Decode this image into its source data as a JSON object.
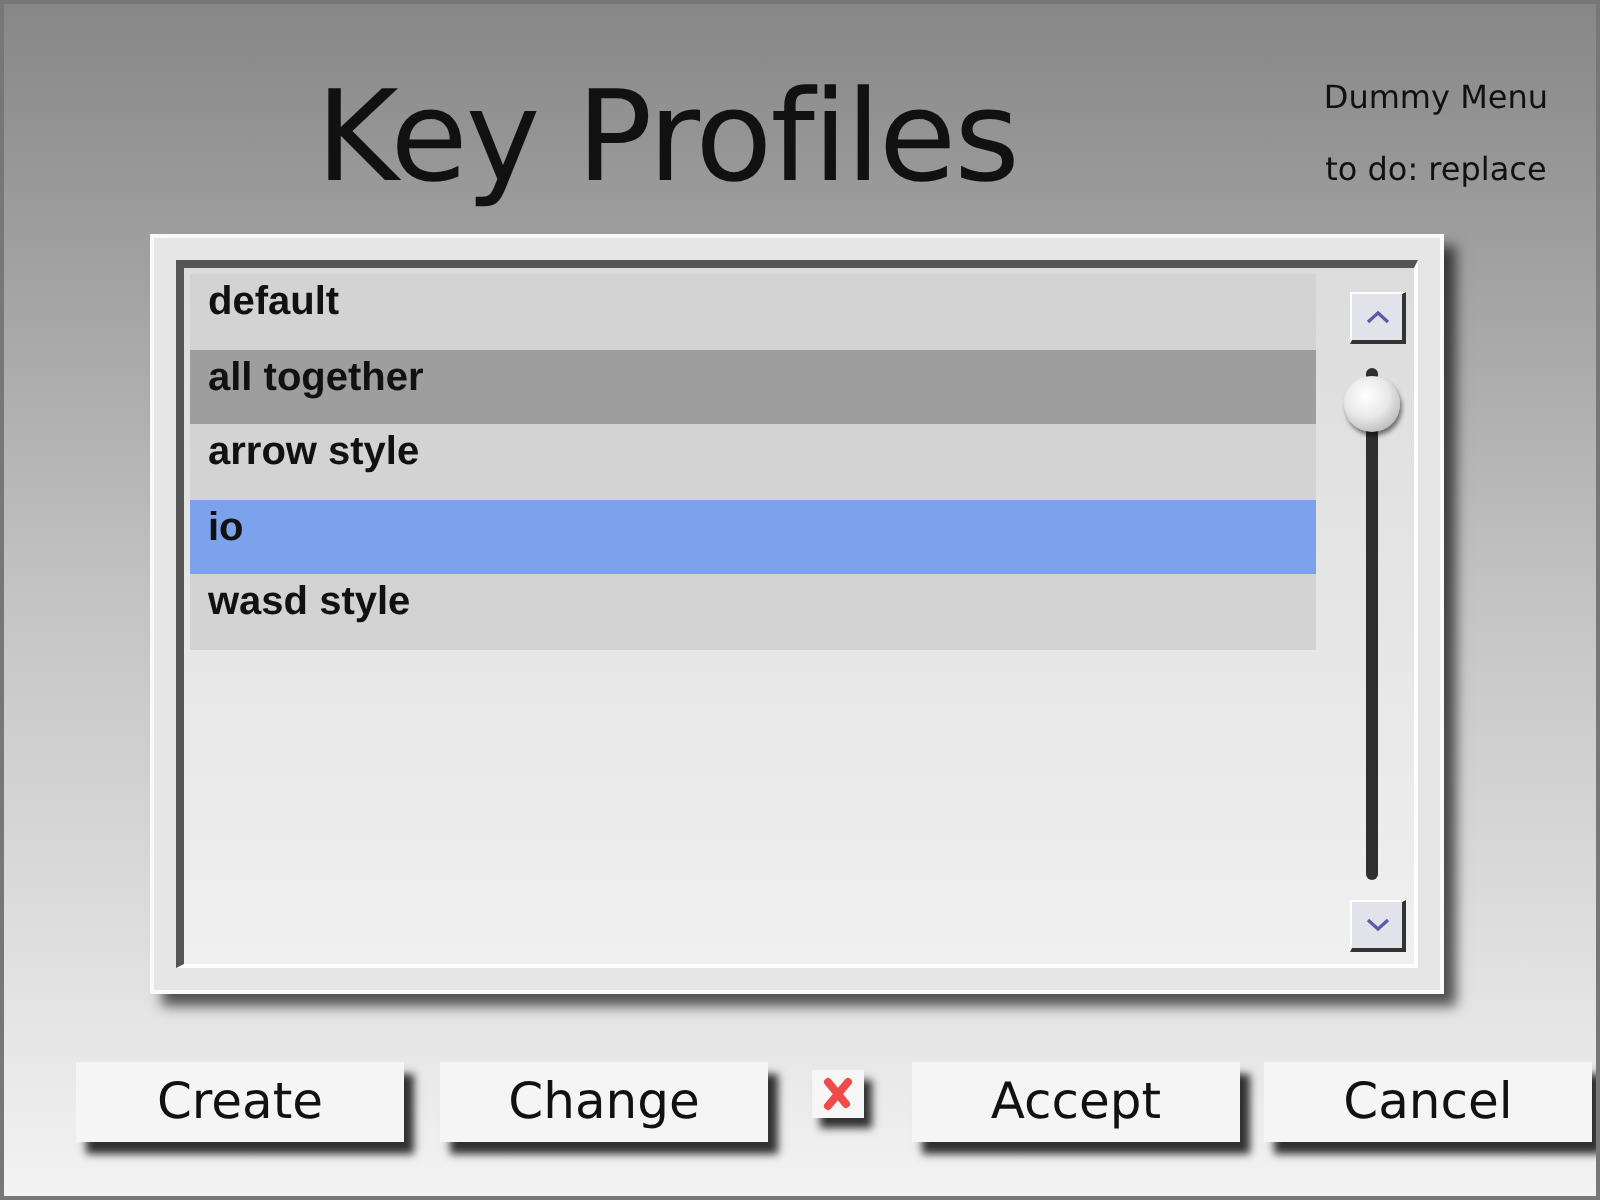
{
  "window": {
    "title": "Key Profiles"
  },
  "menu": {
    "items": [
      "Dummy Menu",
      "to do: replace"
    ]
  },
  "profiles": [
    {
      "name": "default",
      "selected": false,
      "hovered": false
    },
    {
      "name": "all together",
      "selected": false,
      "hovered": true
    },
    {
      "name": "arrow style",
      "selected": false,
      "hovered": false
    },
    {
      "name": "io",
      "selected": true,
      "hovered": false
    },
    {
      "name": "wasd style",
      "selected": false,
      "hovered": false
    }
  ],
  "buttons": [
    {
      "kind": "text",
      "label": "Create"
    },
    {
      "kind": "text",
      "label": "Change"
    },
    {
      "kind": "icon"
    },
    {
      "kind": "text",
      "label": "Accept"
    },
    {
      "kind": "text",
      "label": "Cancel"
    }
  ]
}
